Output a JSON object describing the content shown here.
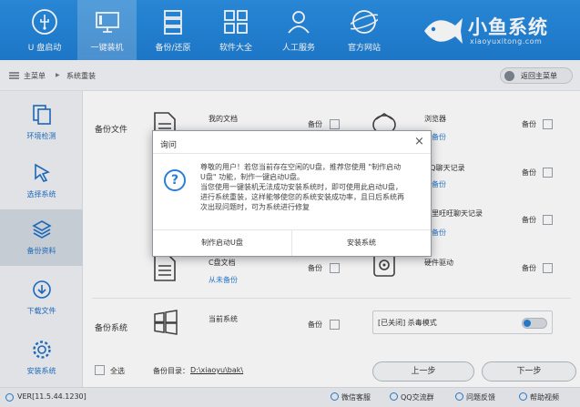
{
  "header": {
    "nav": [
      {
        "label": "U 盘启动",
        "icon": "usb-icon"
      },
      {
        "label": "一键装机",
        "icon": "monitor-icon"
      },
      {
        "label": "备份/还原",
        "icon": "backup-stack-icon"
      },
      {
        "label": "软件大全",
        "icon": "apps-grid-icon"
      },
      {
        "label": "人工服务",
        "icon": "support-person-icon"
      },
      {
        "label": "官方网站",
        "icon": "globe-icon"
      }
    ],
    "active_nav": "一键装机",
    "brand": "小鱼系统",
    "brand_url": "xiaoyuxitong.com"
  },
  "breadcrumb": {
    "home": "主菜单",
    "separator": "▶",
    "current": "系统重装",
    "back_label": "返回主菜单"
  },
  "sidebar": {
    "items": [
      {
        "label": "环境检测",
        "icon": "environment-check-icon"
      },
      {
        "label": "选择系统",
        "icon": "cursor-select-icon"
      },
      {
        "label": "备份资料",
        "icon": "layers-icon"
      },
      {
        "label": "下载文件",
        "icon": "download-icon"
      },
      {
        "label": "安装系统",
        "icon": "gear-icon"
      }
    ],
    "active": "备份资料"
  },
  "backup": {
    "files_label": "备份文件",
    "system_label": "备份系统",
    "backup_checkbox_label": "备份",
    "items": [
      {
        "name": "我的文档",
        "status": "",
        "icon": "document-icon"
      },
      {
        "name": "浏览器",
        "status": "未备份",
        "icon": "browser-icon"
      },
      {
        "name": "QQ聊天记录",
        "status": "未备份",
        "icon": "chat-icon"
      },
      {
        "name": "阿里旺旺聊天记录",
        "status": "未备份",
        "icon": "chat-icon"
      },
      {
        "name": "C盘文档",
        "status": "从未备份",
        "icon": "document-icon"
      },
      {
        "name": "硬件驱动",
        "status": "",
        "icon": "hardware-driver-icon"
      },
      {
        "name": "当前系统",
        "status": "",
        "icon": "windows-icon"
      }
    ],
    "turbo_mode": "[已关闭] 杀毒模式",
    "select_all": "全选",
    "dir_label": "备份目录：",
    "dir_path": "D:\\xiaoyu\\bak\\",
    "prev_button": "上一步",
    "next_button": "下一步"
  },
  "status": {
    "version": "VER[11.5.44.1230]",
    "links": [
      "微信客服",
      "QQ交流群",
      "问题反馈",
      "帮助视频"
    ]
  },
  "dialog": {
    "title": "询问",
    "close": "×",
    "message_lines": [
      "尊敬的用户！若您当前存在空闲的U盘，推荐您使用 \"制作启动",
      "U盘\" 功能，制作一键启动U盘。",
      "当您使用一键装机无法成功安装系统时，即可使用此启动U盘，",
      "进行系统重装，这样能够使您的系统安装成功率，且日后系统再",
      "次出现问题时，可为系统进行修复"
    ],
    "button_left": "制作启动U盘",
    "button_right": "安装系统"
  },
  "colors": {
    "header_blue": "#2b8fe2",
    "accent_blue": "#2a7fd4",
    "sidebar_bg": "#eef1f5"
  }
}
